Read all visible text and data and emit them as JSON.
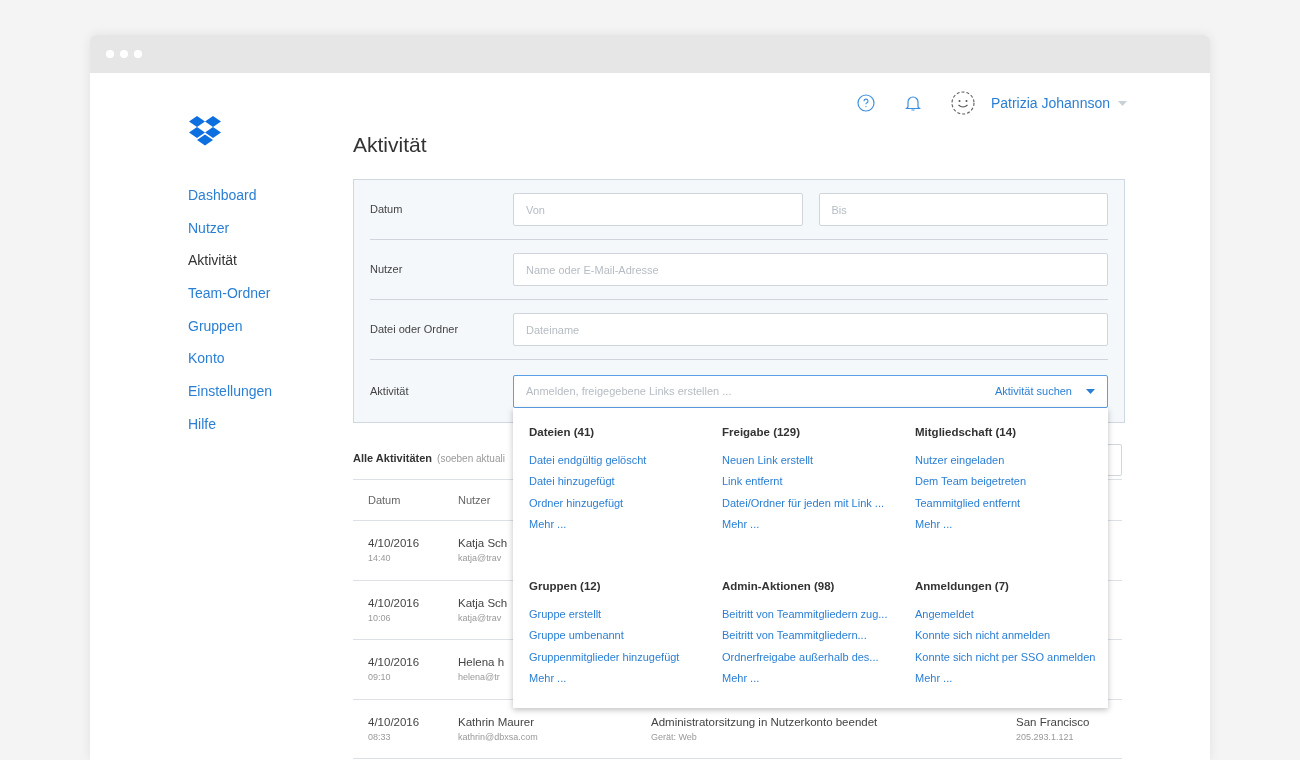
{
  "header": {
    "user": "Patrizia Johannson"
  },
  "sidebar": {
    "items": [
      {
        "label": "Dashboard",
        "selected": false
      },
      {
        "label": "Nutzer",
        "selected": false
      },
      {
        "label": "Aktivität",
        "selected": true
      },
      {
        "label": "Team-Ordner",
        "selected": false
      },
      {
        "label": "Gruppen",
        "selected": false
      },
      {
        "label": "Konto",
        "selected": false
      },
      {
        "label": "Einstellungen",
        "selected": false
      },
      {
        "label": "Hilfe",
        "selected": false
      }
    ]
  },
  "page_title": "Aktivität",
  "filters": [
    {
      "label": "Datum",
      "fields": [
        {
          "placeholder": "Von"
        },
        {
          "placeholder": "Bis"
        }
      ]
    },
    {
      "label": "Nutzer",
      "fields": [
        {
          "placeholder": "Name oder E-Mail-Adresse"
        }
      ]
    },
    {
      "label": "Datei oder Ordner",
      "fields": [
        {
          "placeholder": "Dateiname"
        }
      ]
    }
  ],
  "activity_filter": {
    "label": "Aktivität",
    "placeholder": "Anmelden, freigegebene Links erstellen ...",
    "action": "Aktivität suchen",
    "expanded": true,
    "groups": [
      {
        "title": "Dateien (41)",
        "items": [
          "Datei endgültig gelöscht",
          "Datei hinzugefügt",
          "Ordner hinzugefügt"
        ],
        "more": "Mehr ..."
      },
      {
        "title": "Freigabe (129)",
        "items": [
          "Neuen Link erstellt",
          "Link entfernt",
          "Datei/Ordner für jeden mit Link ..."
        ],
        "more": "Mehr ..."
      },
      {
        "title": "Mitgliedschaft (14)",
        "items": [
          "Nutzer eingeladen",
          "Dem Team beigetreten",
          "Teammitglied entfernt"
        ],
        "more": "Mehr ..."
      },
      {
        "title": "Gruppen (12)",
        "items": [
          "Gruppe erstellt",
          "Gruppe umbenannt",
          "Gruppenmitglieder hinzugefügt"
        ],
        "more": "Mehr ..."
      },
      {
        "title": "Admin-Aktionen (98)",
        "items": [
          "Beitritt von Teammitgliedern zug...",
          "Beitritt von Teammitgliedern...",
          "Ordnerfreigabe außerhalb des..."
        ],
        "more": "Mehr ..."
      },
      {
        "title": "Anmeldungen (7)",
        "items": [
          "Angemeldet",
          "Konnte sich nicht anmelden",
          "Konnte sich nicht per SSO anmelden"
        ],
        "more": "Mehr ..."
      }
    ]
  },
  "table": {
    "title": "Alle Aktivitäten",
    "note": "(soeben aktuali",
    "columns": [
      "Datum",
      "Nutzer"
    ],
    "rows": [
      {
        "date": "4/10/2016",
        "time": "14:40",
        "user": "Katja Sch",
        "email": "katja@trav"
      },
      {
        "date": "4/10/2016",
        "time": "10:06",
        "user": "Katja Sch",
        "email": "katja@trav"
      },
      {
        "date": "4/10/2016",
        "time": "09:10",
        "user": "Helena h",
        "email": "helena@tr"
      },
      {
        "date": "4/10/2016",
        "time": "08:33",
        "user": "Kathrin Maurer",
        "email": "kathrin@dbxsa.com",
        "activity": "Administratorsitzung in Nutzerkonto beendet",
        "device": "Gerät: Web",
        "location": "San Francisco",
        "ip": "205.293.1.121"
      }
    ]
  }
}
